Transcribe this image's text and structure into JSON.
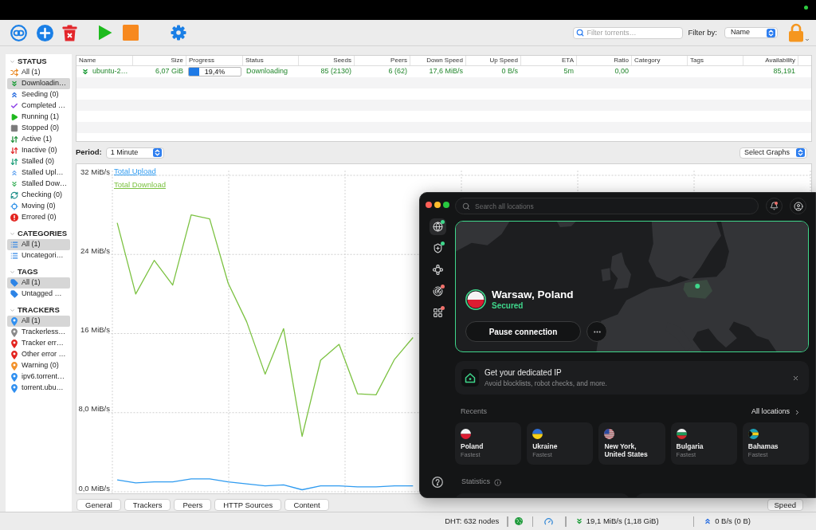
{
  "toolbar": {
    "search": {
      "placeholder": "Filter torrents…"
    },
    "filter_label": "Filter by:",
    "filter_value": "Name"
  },
  "sidebar": {
    "sections": [
      {
        "title": "STATUS",
        "expanded": true,
        "items": [
          {
            "label": "All (1)",
            "selected": false
          },
          {
            "label": "Downloadin…",
            "selected": true
          },
          {
            "label": "Seeding (0)",
            "selected": false
          },
          {
            "label": "Completed …",
            "selected": false
          },
          {
            "label": "Running (1)",
            "selected": false
          },
          {
            "label": "Stopped (0)",
            "selected": false
          },
          {
            "label": "Active (1)",
            "selected": false
          },
          {
            "label": "Inactive (0)",
            "selected": false
          },
          {
            "label": "Stalled (0)",
            "selected": false
          },
          {
            "label": "Stalled Upl…",
            "selected": false
          },
          {
            "label": "Stalled Dow…",
            "selected": false
          },
          {
            "label": "Checking (0)",
            "selected": false
          },
          {
            "label": "Moving (0)",
            "selected": false
          },
          {
            "label": "Errored (0)",
            "selected": false
          }
        ]
      },
      {
        "title": "CATEGORIES",
        "expanded": true,
        "items": [
          {
            "label": "All (1)",
            "selected": true
          },
          {
            "label": "Uncategori…",
            "selected": false
          }
        ]
      },
      {
        "title": "TAGS",
        "expanded": true,
        "items": [
          {
            "label": "All (1)",
            "selected": true
          },
          {
            "label": "Untagged …",
            "selected": false
          }
        ]
      },
      {
        "title": "TRACKERS",
        "expanded": true,
        "items": [
          {
            "label": "All (1)",
            "selected": true,
            "color": "#2f8ff0"
          },
          {
            "label": "Trackerless…",
            "selected": false,
            "color": "#8a8a8a"
          },
          {
            "label": "Tracker err…",
            "selected": false,
            "color": "#e3241f"
          },
          {
            "label": "Other error …",
            "selected": false,
            "color": "#e3241f"
          },
          {
            "label": "Warning (0)",
            "selected": false,
            "color": "#f2922b"
          },
          {
            "label": "ipv6.torrent…",
            "selected": false,
            "color": "#2f8ff0"
          },
          {
            "label": "torrent.ubu…",
            "selected": false,
            "color": "#2f8ff0"
          }
        ]
      }
    ]
  },
  "torrents": {
    "columns": [
      "Name",
      "Size",
      "Progress",
      "Status",
      "Seeds",
      "Peers",
      "Down Speed",
      "Up Speed",
      "ETA",
      "Ratio",
      "Category",
      "Tags",
      "Availability"
    ],
    "rows": [
      {
        "name": "ubuntu-2…",
        "size": "6,07 GiB",
        "progress": {
          "level": 0.194,
          "text": "19,4%"
        },
        "status": "Downloading",
        "seeds": "85 (2130)",
        "peers": "6 (62)",
        "down_speed": "17,6 MiB/s",
        "up_speed": "0 B/s",
        "eta": "5m",
        "ratio": "0,00",
        "availability": "85,191"
      }
    ]
  },
  "graph": {
    "period_label": "Period:",
    "period": "1 Minute",
    "select_graphs": "Select Graphs",
    "chart_data": {
      "type": "line",
      "categories": [
        null,
        null,
        null,
        null,
        null,
        null,
        null,
        null,
        null,
        null,
        null,
        null,
        null,
        null,
        null,
        null,
        null,
        null,
        null,
        null,
        null,
        null,
        null,
        null,
        null,
        null,
        null,
        null,
        null,
        null,
        null,
        null,
        null,
        null,
        null,
        null,
        null,
        null
      ],
      "ylim": [
        0,
        32
      ],
      "yticks": [
        {
          "value": 0,
          "label": "0,0 MiB/s"
        },
        {
          "value": 8,
          "label": "8,0 MiB/s"
        },
        {
          "value": 16,
          "label": "16 MiB/s"
        },
        {
          "value": 24,
          "label": "24 MiB/s"
        },
        {
          "value": 32,
          "label": "32 MiB/s"
        }
      ],
      "grid": true,
      "series": [
        {
          "name": "Total Upload",
          "color": "#2f9bf0",
          "values": [
            1.2,
            0.9,
            1.0,
            1.0,
            1.3,
            1.3,
            1.0,
            0.8,
            0.6,
            0.7,
            0.2,
            0.6,
            0.6,
            0.5,
            0.5,
            0.6,
            0.6,
            null,
            null,
            null,
            null,
            null,
            null,
            null,
            null,
            null,
            null,
            null,
            null,
            null,
            null,
            null,
            null,
            null,
            null,
            null,
            null,
            null
          ]
        },
        {
          "name": "Total Download",
          "color": "#7cc242",
          "values": [
            27.2,
            20.0,
            23.4,
            20.9,
            28.0,
            27.6,
            21.1,
            17.2,
            11.9,
            16.5,
            5.6,
            13.3,
            14.9,
            9.9,
            9.8,
            13.4,
            15.6,
            null,
            null,
            null,
            null,
            null,
            null,
            null,
            null,
            null,
            null,
            null,
            null,
            null,
            null,
            null,
            null,
            null,
            null,
            null,
            null,
            null
          ]
        }
      ]
    }
  },
  "detail_tabs": {
    "left": [
      "General",
      "Trackers",
      "Peers",
      "HTTP Sources",
      "Content"
    ],
    "right": [
      "Speed"
    ]
  },
  "status_bar": {
    "dht": "DHT: 632 nodes",
    "download": "19,1 MiB/s (1,18 GiB)",
    "upload": "0 B/s (0 B)"
  },
  "vpn_window": {
    "search": {
      "placeholder": "Search all locations"
    },
    "notifications": {
      "unread": true
    },
    "rail": [
      {
        "selected": true,
        "color": "#3fd68b"
      },
      {
        "selected": false,
        "color": "#3fd68b"
      },
      {
        "selected": false
      },
      {
        "selected": false,
        "color": "#f0716b"
      },
      {
        "selected": false,
        "color": "#f0716b"
      }
    ],
    "connection": {
      "location": "Warsaw, Poland",
      "status": "Secured",
      "pause_button": "Pause connection"
    },
    "promo": {
      "title": "Get your dedicated IP",
      "text": "Avoid blocklists, robot checks, and more."
    },
    "recents": {
      "title": "Recents",
      "link": "All locations",
      "items": [
        {
          "name": "Poland",
          "detail": "Fastest"
        },
        {
          "name": "Ukraine",
          "detail": "Fastest"
        },
        {
          "name": "New York, United States"
        },
        {
          "name": "Bulgaria",
          "detail": "Fastest"
        },
        {
          "name": "Bahamas",
          "detail": "Fastest"
        }
      ]
    },
    "statistics": {
      "title": "Statistics"
    }
  }
}
